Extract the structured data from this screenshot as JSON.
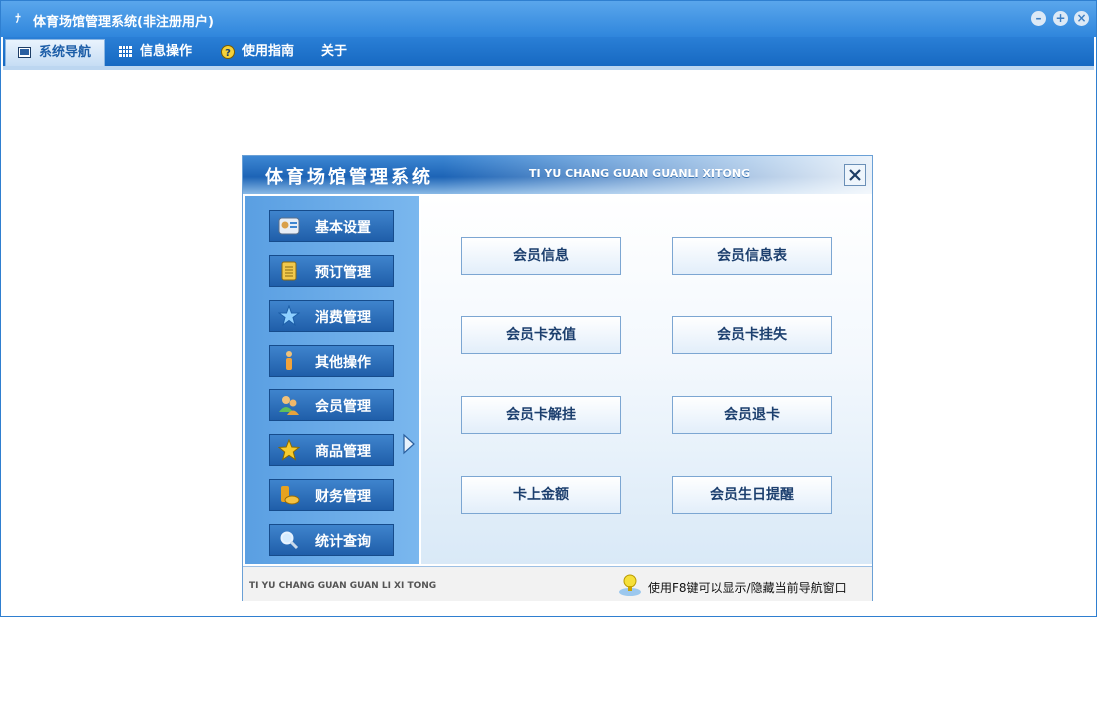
{
  "window": {
    "title": "体育场馆管理系统(非注册用户)",
    "controls": {
      "minimize": "minimize-icon",
      "maximize": "maximize-icon",
      "close": "close-icon"
    }
  },
  "menubar": {
    "tabs": [
      {
        "label": "系统导航",
        "icon": "monitor-icon",
        "active": true
      },
      {
        "label": "信息操作",
        "icon": "grid-icon",
        "active": false
      },
      {
        "label": "使用指南",
        "icon": "help-icon",
        "active": false
      },
      {
        "label": "关于",
        "icon": "",
        "active": false
      }
    ]
  },
  "dialog": {
    "title": "体育场馆管理系统",
    "subtitle": "TI YU CHANG GUAN GUANLI XITONG",
    "sidebar": [
      {
        "label": "基本设置",
        "icon": "contacts-icon"
      },
      {
        "label": "预订管理",
        "icon": "document-icon"
      },
      {
        "label": "消费管理",
        "icon": "star-burst-icon"
      },
      {
        "label": "其他操作",
        "icon": "person-info-icon"
      },
      {
        "label": "会员管理",
        "icon": "users-icon",
        "selected": true
      },
      {
        "label": "商品管理",
        "icon": "star-icon"
      },
      {
        "label": "财务管理",
        "icon": "coins-icon"
      },
      {
        "label": "统计查询",
        "icon": "magnifier-icon"
      }
    ],
    "actions": [
      {
        "label": "会员信息"
      },
      {
        "label": "会员信息表"
      },
      {
        "label": "会员卡充值"
      },
      {
        "label": "会员卡挂失"
      },
      {
        "label": "会员卡解挂"
      },
      {
        "label": "会员退卡"
      },
      {
        "label": "卡上金额"
      },
      {
        "label": "会员生日提醒"
      }
    ],
    "footer": {
      "left": "TI YU CHANG GUAN GUAN LI XI TONG",
      "right": "使用F8键可以显示/隐藏当前导航窗口"
    }
  },
  "colors": {
    "titlebar": "#2f86dc",
    "menubar": "#1769c2",
    "sidebar_button": "#2a6db8"
  }
}
